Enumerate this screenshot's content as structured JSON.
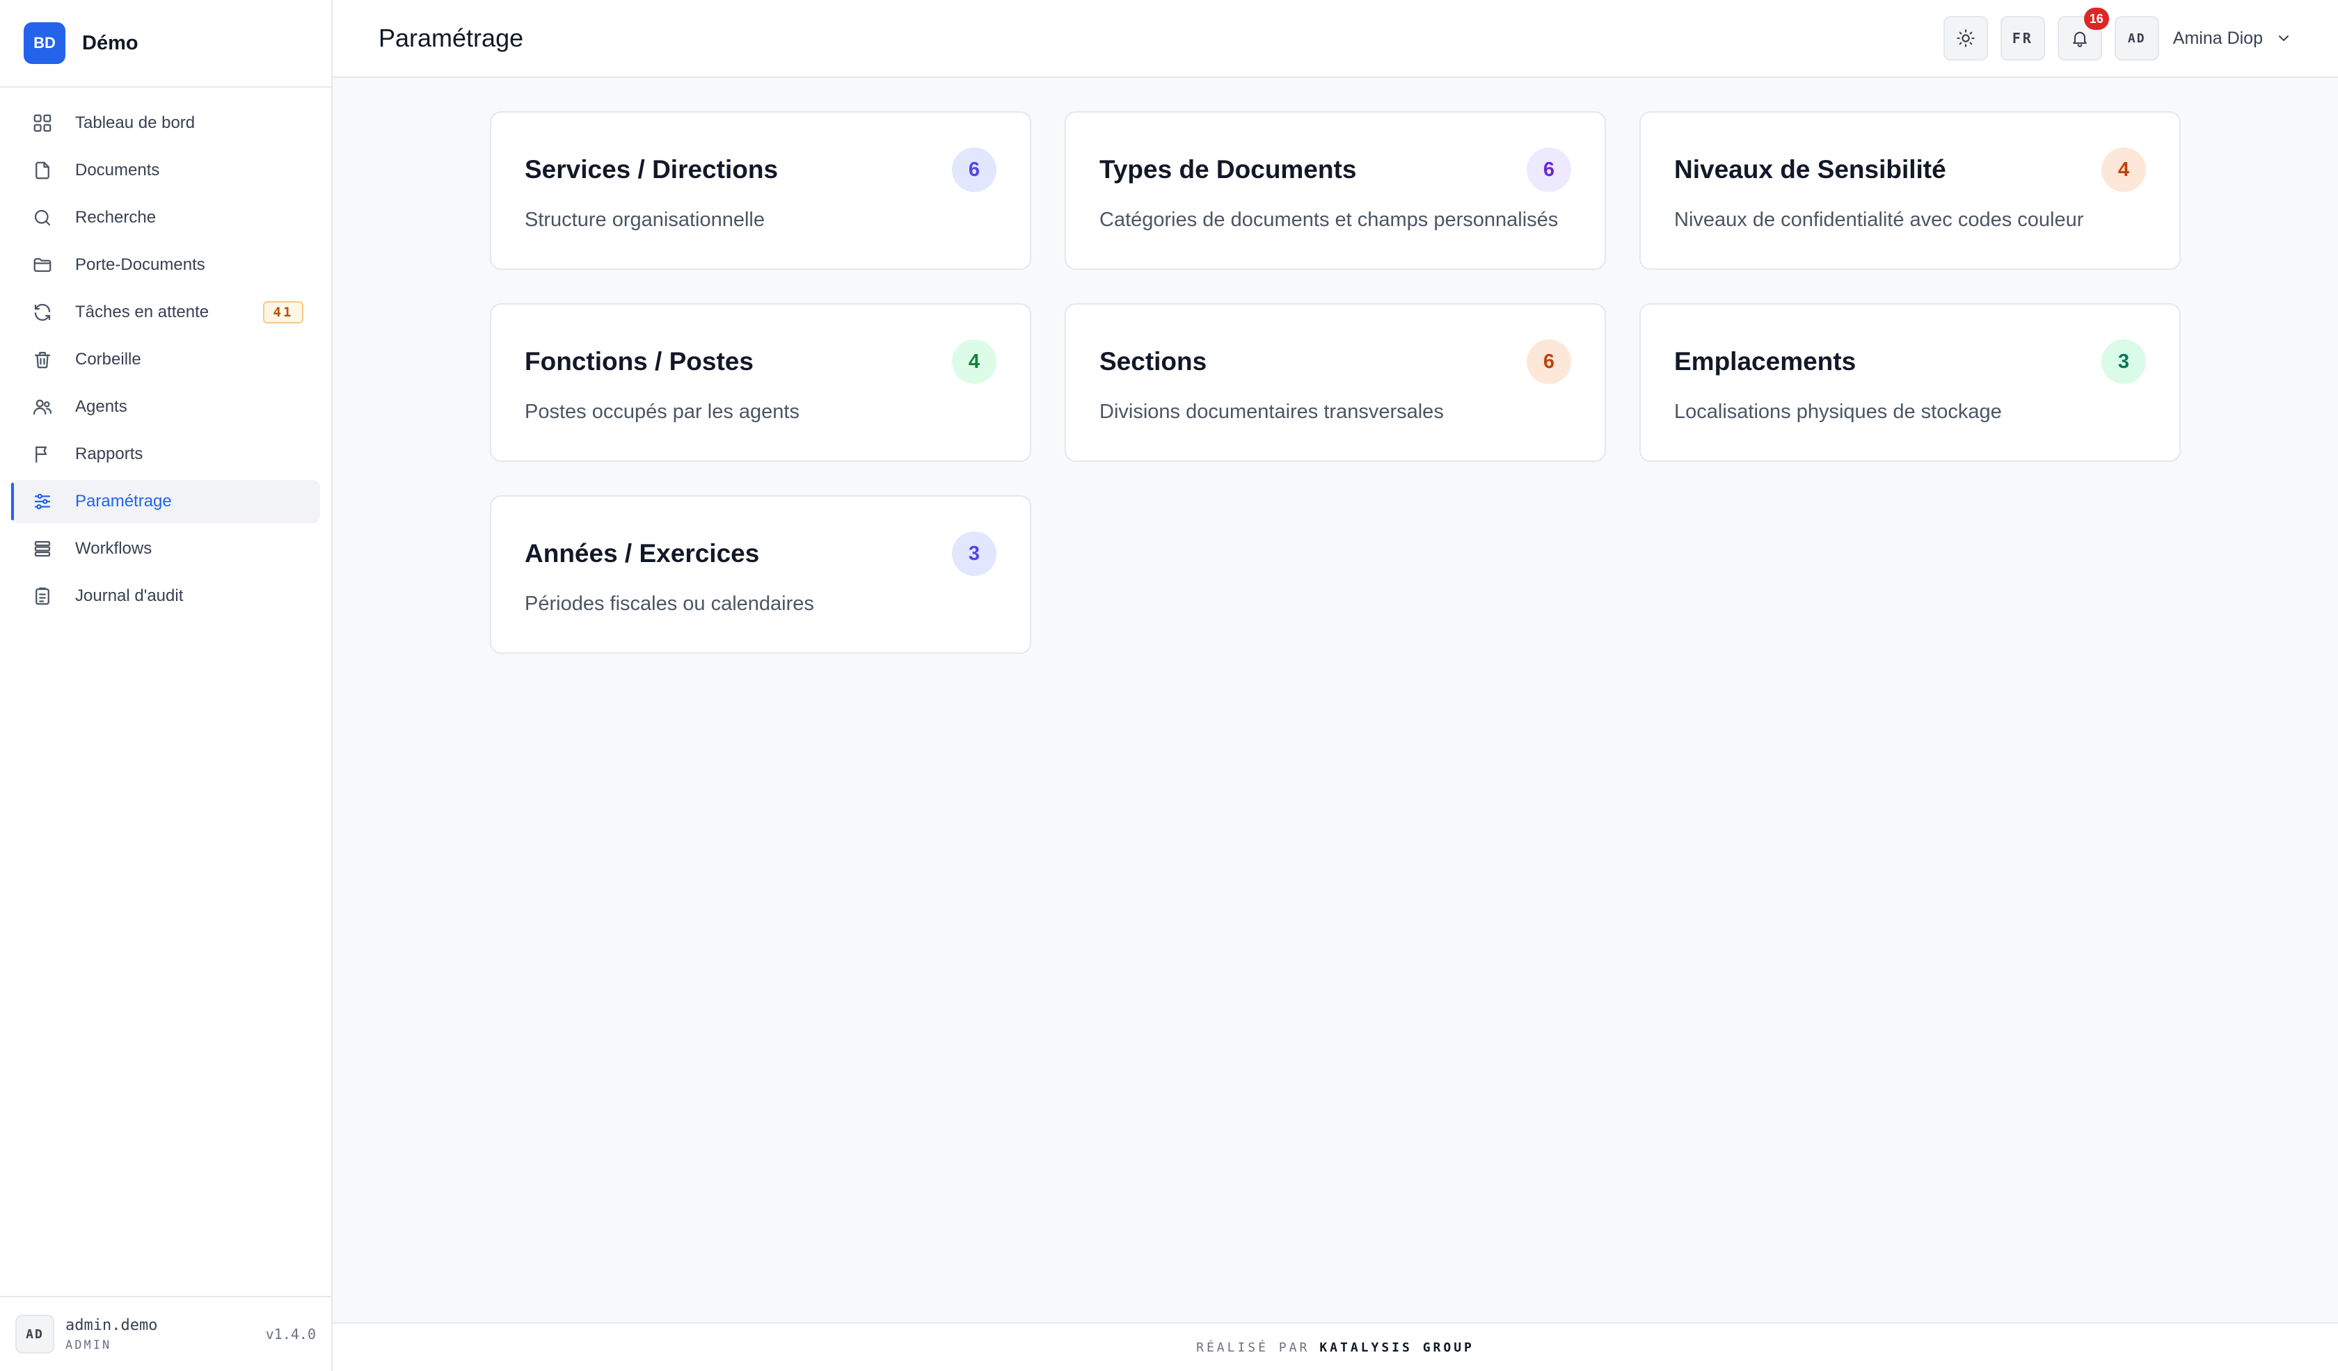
{
  "brand": {
    "logo_text": "BD",
    "name": "Démo"
  },
  "sidebar": {
    "items": [
      {
        "label": "Tableau de bord",
        "icon": "dashboard-grid-icon"
      },
      {
        "label": "Documents",
        "icon": "file-icon"
      },
      {
        "label": "Recherche",
        "icon": "search-icon"
      },
      {
        "label": "Porte-Documents",
        "icon": "folder-icon"
      },
      {
        "label": "Tâches en attente",
        "icon": "refresh-icon",
        "badge": "41"
      },
      {
        "label": "Corbeille",
        "icon": "trash-icon"
      },
      {
        "label": "Agents",
        "icon": "users-icon"
      },
      {
        "label": "Rapports",
        "icon": "flag-icon"
      },
      {
        "label": "Paramétrage",
        "icon": "sliders-icon",
        "active": true
      },
      {
        "label": "Workflows",
        "icon": "layers-icon"
      },
      {
        "label": "Journal d'audit",
        "icon": "clipboard-icon"
      }
    ],
    "footer": {
      "avatar": "AD",
      "username": "admin.demo",
      "role": "ADMIN",
      "version": "v1.4.0"
    }
  },
  "header": {
    "title": "Paramétrage",
    "lang": "FR",
    "notifications": "16",
    "avatar": "AD",
    "user_name": "Amina Diop"
  },
  "cards": [
    {
      "title": "Services / Directions",
      "count": "6",
      "description": "Structure organisationnelle",
      "count_bg": "#e0e7ff",
      "count_color": "#4f46e5"
    },
    {
      "title": "Types de Documents",
      "count": "6",
      "description": "Catégories de documents et champs personnalisés",
      "count_bg": "#ede9fe",
      "count_color": "#6d28d9"
    },
    {
      "title": "Niveaux de Sensibilité",
      "count": "4",
      "description": "Niveaux de confidentialité avec codes couleur",
      "count_bg": "#fde7d9",
      "count_color": "#c2410c"
    },
    {
      "title": "Fonctions / Postes",
      "count": "4",
      "description": "Postes occupés par les agents",
      "count_bg": "#dcfce7",
      "count_color": "#15803d"
    },
    {
      "title": "Sections",
      "count": "6",
      "description": "Divisions documentaires transversales",
      "count_bg": "#fde7d9",
      "count_color": "#c2410c"
    },
    {
      "title": "Emplacements",
      "count": "3",
      "description": "Localisations physiques de stockage",
      "count_bg": "#d9fbe8",
      "count_color": "#047857"
    },
    {
      "title": "Années / Exercices",
      "count": "3",
      "description": "Périodes fiscales ou calendaires",
      "count_bg": "#e0e7ff",
      "count_color": "#4f46e5"
    }
  ],
  "footer": {
    "prefix": "RÉALISÉ PAR",
    "company": "KATALYSIS GROUP"
  },
  "colors": {
    "accent": "#2563eb",
    "notification": "#dc2626",
    "badge_border": "#f6c98a"
  }
}
